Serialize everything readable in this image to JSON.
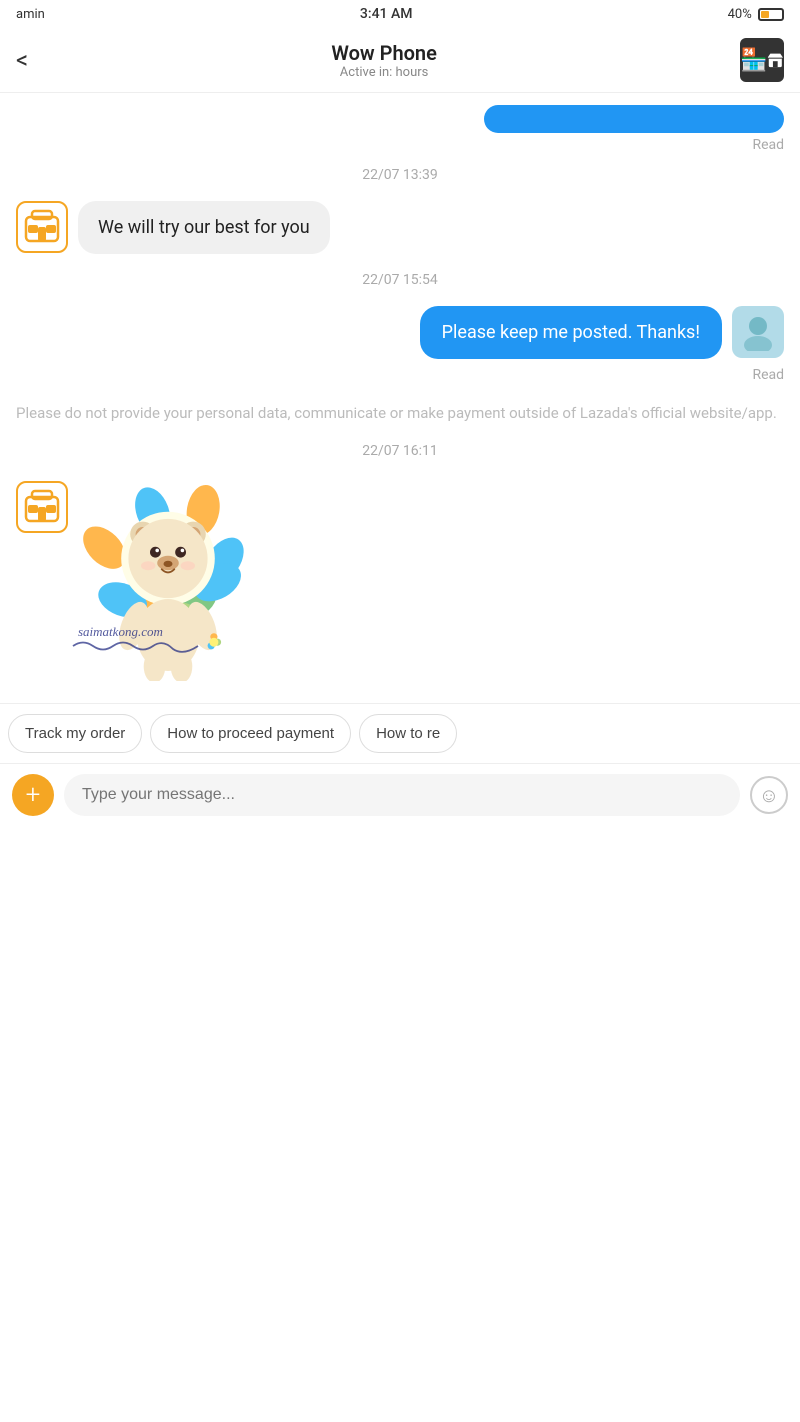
{
  "statusBar": {
    "carrier": "amin",
    "time": "3:41 AM",
    "battery": "40%"
  },
  "header": {
    "backLabel": "<",
    "shopName": "Wow Phone",
    "shopStatus": "Active in: hours",
    "shopIconLabel": "store-icon"
  },
  "messages": [
    {
      "type": "sent-top",
      "content": "",
      "readLabel": "Read"
    },
    {
      "type": "timestamp",
      "text": "22/07 13:39"
    },
    {
      "type": "received",
      "text": "We will try our best for you"
    },
    {
      "type": "timestamp",
      "text": "22/07 15:54"
    },
    {
      "type": "sent",
      "text": "Please keep me posted. Thanks!",
      "readLabel": "Read"
    },
    {
      "type": "notice",
      "text": "Please do not provide your personal data, communicate or make payment outside of Lazada's official website/app."
    },
    {
      "type": "timestamp",
      "text": "22/07 16:11"
    },
    {
      "type": "sticker",
      "watermark": "saimatkong.com"
    }
  ],
  "quickReplies": [
    {
      "label": "Track my order"
    },
    {
      "label": "How to proceed payment"
    },
    {
      "label": "How to re"
    }
  ],
  "inputBar": {
    "placeholder": "Type your message...",
    "addLabel": "+",
    "emojiLabel": "☺"
  }
}
